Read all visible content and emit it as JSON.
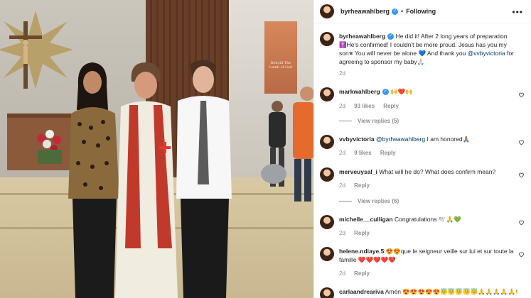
{
  "post": {
    "username": "byrheawahlberg",
    "follow_state": "Following",
    "caption_username": "byrheawahlberg",
    "caption_text": "He did it! After 2 long years of preparation ✝️He's confirmed! I couldn't be more proud. Jesus has you my son🕿 You will never be alone 💙 And thank you",
    "caption_mention": "@vvbyvictoria",
    "caption_tail": "for agreeing to sponsor my baby🙏🏻",
    "caption_time": "2d",
    "photo_banner_text": "Behold The Lamb of God"
  },
  "comments": [
    {
      "username": "markwahlberg",
      "text": "🙌❤️🙌",
      "time": "2d",
      "likes": "93 likes",
      "reply": "Reply",
      "verified": true,
      "view_replies": "View replies (5)"
    },
    {
      "username": "vvbyvictoria",
      "mention": "@byrheawahlberg",
      "text": "I am honored🙏🏽",
      "time": "2d",
      "likes": "9 likes",
      "reply": "Reply",
      "verified": false
    },
    {
      "username": "merveuysal_i",
      "text": "What will he do? What does confirm mean?",
      "time": "2d",
      "reply": "Reply",
      "verified": false,
      "view_replies": "View replies (6)"
    },
    {
      "username": "michelle__culligan",
      "text": "Congratulations 🕊️🙏💚",
      "time": "2d",
      "reply": "Reply",
      "verified": false
    },
    {
      "username": "helene.ndiaye.5",
      "text": "😍😍que le seigneur veille sur lui et sur toute la famille ❤️❤️❤️❤️❤️",
      "time": "2d",
      "reply": "Reply",
      "verified": false
    },
    {
      "username": "carlaandreariva",
      "text": "Amén 😍😍😍😍😍😇😇😇😇😇🙏🙏🙏🙏🙏😍",
      "verified": false
    }
  ],
  "colors": {
    "verified": "#3897f0",
    "link": "#00376b",
    "muted": "#8e8e8e"
  }
}
